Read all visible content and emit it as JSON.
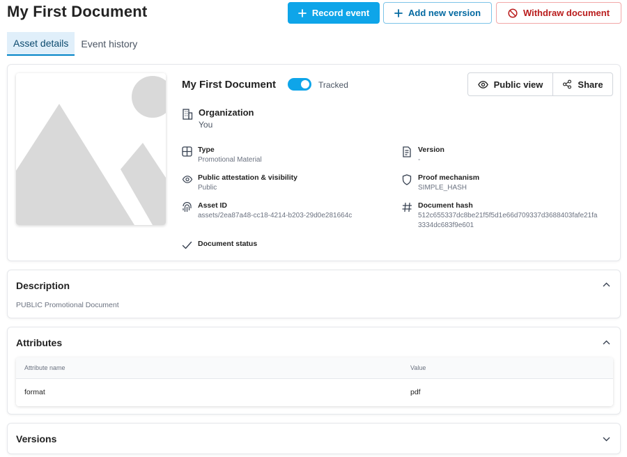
{
  "header": {
    "title": "My First Document",
    "record_event": "Record event",
    "add_version": "Add new version",
    "withdraw": "Withdraw document"
  },
  "tabs": [
    {
      "label": "Asset details",
      "active": true
    },
    {
      "label": "Event history",
      "active": false
    }
  ],
  "asset": {
    "name": "My First Document",
    "tracked_label": "Tracked",
    "tracked": true,
    "public_view": "Public view",
    "share": "Share",
    "organization_label": "Organization",
    "organization_value": "You",
    "type_label": "Type",
    "type_value": "Promotional Material",
    "version_label": "Version",
    "version_value": "-",
    "visibility_label": "Public attestation & visibility",
    "visibility_value": "Public",
    "proof_label": "Proof mechanism",
    "proof_value": "SIMPLE_HASH",
    "asset_id_label": "Asset ID",
    "asset_id_value": "assets/2ea87a48-cc18-4214-b203-29d0e281664c",
    "hash_label": "Document hash",
    "hash_line1": "512c655337dc8be21f5f5d1e66d709337d3688403fafe21fa",
    "hash_line2": "3334dc683f9e601",
    "status_label": "Document status"
  },
  "description": {
    "title": "Description",
    "text": "PUBLIC Promotional Document"
  },
  "attributes": {
    "title": "Attributes",
    "columns": [
      "Attribute name",
      "Value"
    ],
    "rows": [
      {
        "name": "format",
        "value": "pdf"
      }
    ]
  },
  "versions": {
    "title": "Versions"
  },
  "colors": {
    "primary": "#0ea5e9",
    "danger": "#b91c1c",
    "tab_active_bg": "#e0effa"
  },
  "icons": [
    "plus-icon",
    "ban-icon",
    "eye-icon",
    "share-icon",
    "building-icon",
    "grid-icon",
    "file-version-icon",
    "shield-icon",
    "fingerprint-icon",
    "hash-icon",
    "check-icon",
    "chevron-up-icon",
    "chevron-down-icon",
    "image-placeholder-icon"
  ]
}
